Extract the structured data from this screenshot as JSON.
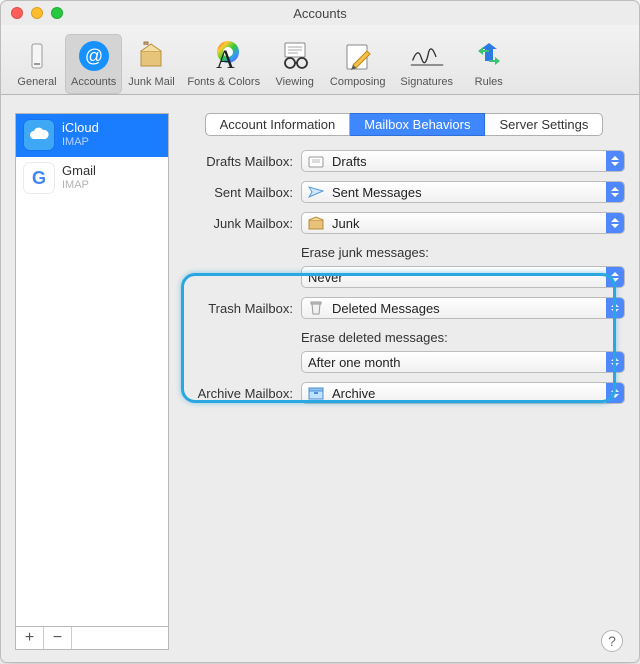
{
  "window": {
    "title": "Accounts"
  },
  "toolbar": {
    "items": [
      {
        "label": "General"
      },
      {
        "label": "Accounts"
      },
      {
        "label": "Junk Mail"
      },
      {
        "label": "Fonts & Colors"
      },
      {
        "label": "Viewing"
      },
      {
        "label": "Composing"
      },
      {
        "label": "Signatures"
      },
      {
        "label": "Rules"
      }
    ],
    "selected_index": 1
  },
  "accounts": {
    "list": [
      {
        "name": "iCloud",
        "protocol": "IMAP"
      },
      {
        "name": "Gmail",
        "protocol": "IMAP"
      }
    ],
    "selected_index": 0
  },
  "tabs": {
    "items": [
      "Account Information",
      "Mailbox Behaviors",
      "Server Settings"
    ],
    "selected_index": 1
  },
  "mailbox_behaviors": {
    "drafts": {
      "label": "Drafts Mailbox:",
      "value": "Drafts"
    },
    "sent": {
      "label": "Sent Mailbox:",
      "value": "Sent Messages"
    },
    "junk": {
      "label": "Junk Mailbox:",
      "value": "Junk"
    },
    "erase_junk": {
      "label": "Erase junk messages:",
      "value": "Never"
    },
    "trash": {
      "label": "Trash Mailbox:",
      "value": "Deleted Messages"
    },
    "erase_deleted": {
      "label": "Erase deleted messages:",
      "value": "After one month"
    },
    "archive": {
      "label": "Archive Mailbox:",
      "value": "Archive"
    }
  },
  "footer": {
    "add": "+",
    "remove": "−"
  },
  "help_glyph": "?",
  "icons": {
    "cloud_bg": "#3fa8f4",
    "google_g": "G",
    "accent": "#3f87ff",
    "highlight": "#2aa7e0"
  }
}
